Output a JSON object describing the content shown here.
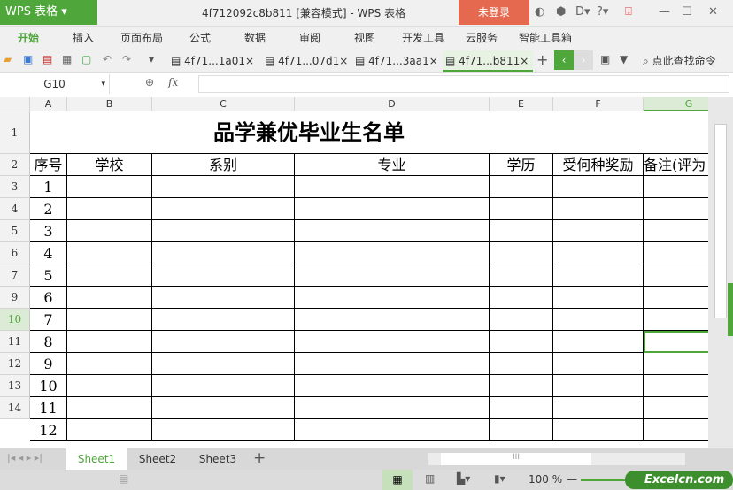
{
  "app": {
    "name": "WPS 表格",
    "title": "4f712092c8b811 [兼容模式] - WPS 表格",
    "login": "未登录"
  },
  "menu": [
    "开始",
    "插入",
    "页面布局",
    "公式",
    "数据",
    "审阅",
    "视图",
    "开发工具",
    "云服务",
    "智能工具箱"
  ],
  "doc_tabs": [
    "4f71...1a01",
    "4f71...07d1",
    "4f71...3aa1",
    "4f71...b811"
  ],
  "search_label": "点此查找命令",
  "namebox": "G10",
  "fx": "fx",
  "columns": [
    "A",
    "B",
    "C",
    "D",
    "E",
    "F",
    "G"
  ],
  "row_numbers": [
    "1",
    "2",
    "3",
    "4",
    "5",
    "6",
    "7",
    "9",
    "10",
    "11",
    "12",
    "13",
    "14"
  ],
  "sheet_title": "品学兼优毕业生名单",
  "headers": [
    "序号",
    "学校",
    "系别",
    "专业",
    "学历",
    "受何种奖励",
    "备注(评为"
  ],
  "seq": [
    "1",
    "2",
    "3",
    "4",
    "5",
    "6",
    "7",
    "8",
    "9",
    "10",
    "11",
    "12"
  ],
  "sheets": [
    "Sheet1",
    "Sheet2",
    "Sheet3"
  ],
  "zoom": "100 %",
  "watermark": "Excelcn.com",
  "accent": "#4fa63a"
}
